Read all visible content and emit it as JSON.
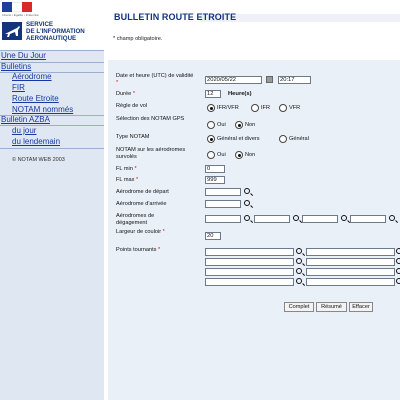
{
  "logo": {
    "flag_colors": [
      "#1f3d99",
      "#ffffff",
      "#d62a2a"
    ],
    "flag_caption": "Liberté • Égalité • Fraternité",
    "line1": "SERVICE",
    "line2": "DE L'INFORMATION",
    "line3": "AERONAUTIQUE"
  },
  "sidebar": {
    "items": [
      {
        "label": "Une Du Jour"
      },
      {
        "label": "Bulletins"
      },
      {
        "label": "Aérodrome"
      },
      {
        "label": "FIR"
      },
      {
        "label": "Route Etroite"
      },
      {
        "label": "NOTAM nommés"
      },
      {
        "label": "Bulletin AZBA"
      },
      {
        "label": "du jour"
      },
      {
        "label": "du lendemain"
      }
    ],
    "copyright": "© NOTAM WEB 2003"
  },
  "main": {
    "title": "BULLETIN ROUTE ETROITE",
    "required_note": "* champ obligatoire."
  },
  "form": {
    "datetime": {
      "label": "Date et heure (UTC) de validité",
      "req": "*",
      "date": "2020/05/22",
      "time": "20:17"
    },
    "duration": {
      "label": "Durée",
      "req": "*",
      "value": "12",
      "unit": "Heure(s)"
    },
    "flight_rule": {
      "label": "Règle de vol",
      "options": [
        "IFR/VFR",
        "IFR",
        "VFR"
      ],
      "selected": "IFR/VFR"
    },
    "gps": {
      "label": "Sélection des NOTAM GPS",
      "options": [
        "Oui",
        "Non"
      ],
      "selected": "Non"
    },
    "notam_type": {
      "label": "Type NOTAM",
      "options": [
        "Général et divers",
        "Général"
      ],
      "selected": "Général et divers"
    },
    "overflown": {
      "label": "NOTAM sur les aérodromes survolés",
      "options": [
        "Oui",
        "Non"
      ],
      "selected": "Non"
    },
    "fl_min": {
      "label": "FL min",
      "req": "*",
      "value": "0"
    },
    "fl_max": {
      "label": "FL max",
      "req": "*",
      "value": "999"
    },
    "departure": {
      "label": "Aérodrome de départ",
      "value": ""
    },
    "arrival": {
      "label": "Aérodrome d'arrivée",
      "value": ""
    },
    "alternate": {
      "label": "Aérodromes de dégagement",
      "values": [
        "",
        "",
        "",
        ""
      ]
    },
    "corridor": {
      "label": "Largeur de couloir",
      "req": "*",
      "value": "20"
    },
    "waypoints": {
      "label": "Points tournants",
      "req": "*"
    },
    "buttons": {
      "complete": "Complet",
      "summary": "Résumé",
      "clear": "Effacer"
    }
  },
  "colors": {
    "brand": "#13337a",
    "link": "#1838a0",
    "sidebar_bg": "#dfe7f3",
    "form_bg": "#eaf0f8",
    "required": "#cc1111"
  }
}
